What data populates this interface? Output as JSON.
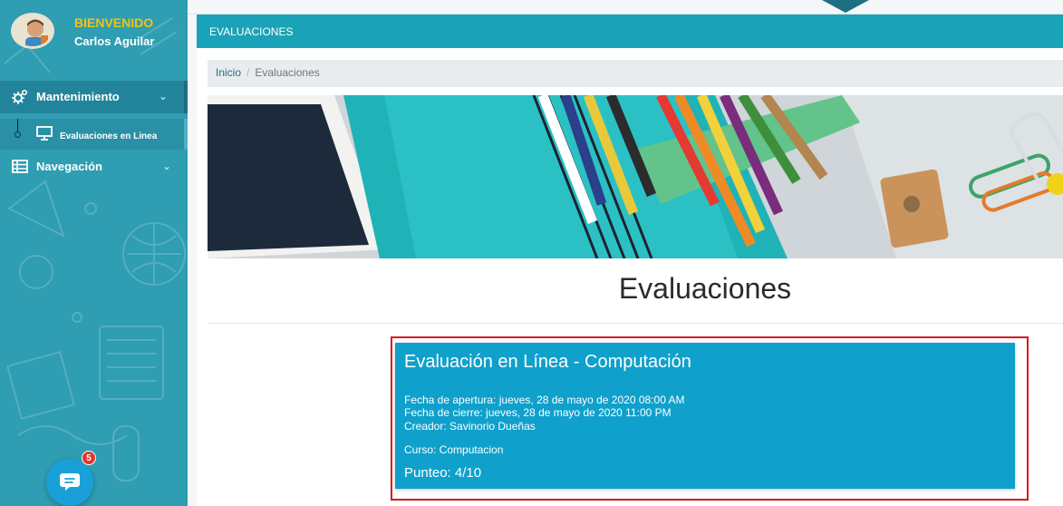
{
  "sidebar": {
    "welcome": "BIENVENIDO",
    "username": "Carlos Aguilar",
    "items": [
      {
        "label": "Mantenimiento",
        "icon": "gears-icon"
      },
      {
        "label": "Evaluaciones en Linea",
        "icon": "monitor-icon"
      },
      {
        "label": "Navegación",
        "icon": "table-icon"
      }
    ],
    "chat_badge": "5"
  },
  "header": {
    "title": "EVALUACIONES"
  },
  "breadcrumb": {
    "home": "Inicio",
    "current": "Evaluaciones"
  },
  "main": {
    "page_title": "Evaluaciones"
  },
  "card": {
    "title": "Evaluación en Línea - Computación",
    "apertura": "Fecha de apertura: jueves, 28 de mayo de 2020 08:00 AM",
    "cierre": "Fecha de cierre: jueves, 28 de mayo de 2020 11:00 PM",
    "creador": "Creador: Savinorio Dueñas",
    "curso": "Curso: Computacion",
    "punteo": "Punteo: 4/10"
  },
  "colors": {
    "sidebar": "#2f9db2",
    "header": "#1aa3b8",
    "card": "#0fa0cc",
    "highlight": "#d7191f",
    "welcome": "#f1c40f"
  }
}
